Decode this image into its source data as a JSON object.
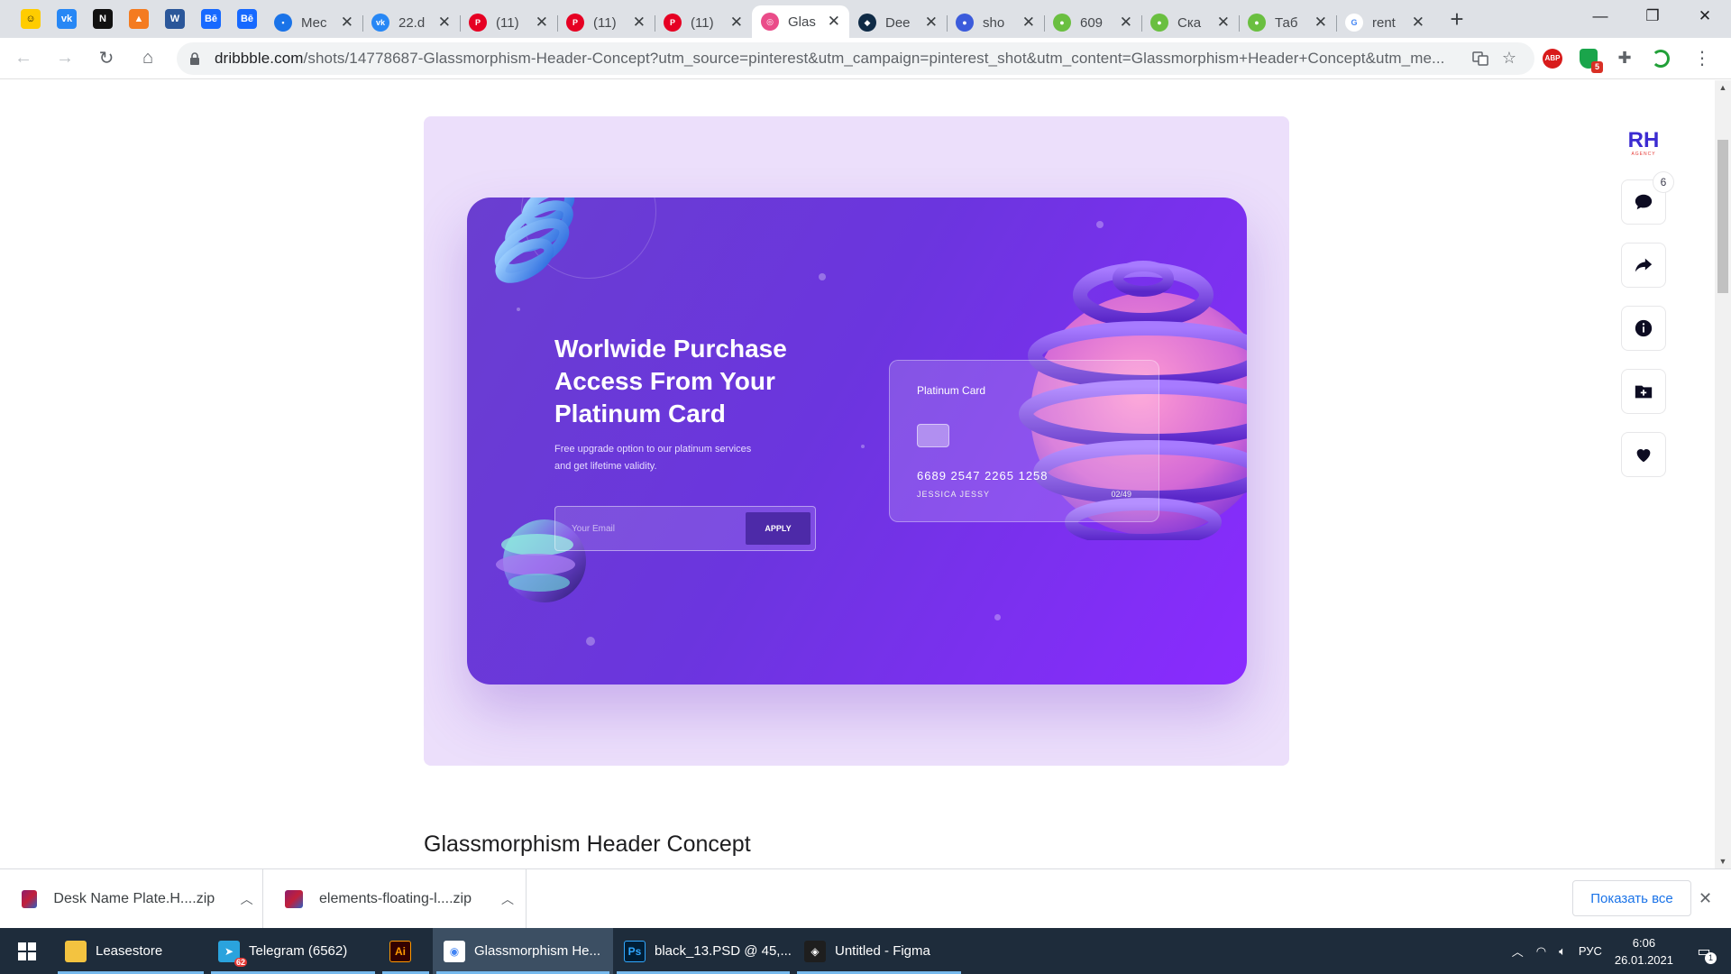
{
  "browser": {
    "pinned_tabs": [
      {
        "icon": "yandex-smile-icon",
        "color": "#ffcc00",
        "glyph": "☺"
      },
      {
        "icon": "vk-icon",
        "color": "#2787f5",
        "glyph": "vk"
      },
      {
        "icon": "notion-icon",
        "color": "#111111",
        "glyph": "N"
      },
      {
        "icon": "tilda-icon",
        "color": "#f47b20",
        "glyph": "▲"
      },
      {
        "icon": "word-icon",
        "color": "#2b579a",
        "glyph": "W"
      },
      {
        "icon": "behance-icon",
        "color": "#1769ff",
        "glyph": "Bē"
      },
      {
        "icon": "behance-icon",
        "color": "#1769ff",
        "glyph": "Bē"
      }
    ],
    "tabs": [
      {
        "title": "Мес",
        "icon": "chat-icon",
        "color": "#1a73e8",
        "glyph": "▪",
        "active": false
      },
      {
        "title": "22.d",
        "icon": "vk-icon",
        "color": "#2787f5",
        "glyph": "vk",
        "active": false
      },
      {
        "title": "(11)",
        "icon": "pinterest-icon",
        "color": "#e60023",
        "glyph": "P",
        "active": false
      },
      {
        "title": "(11)",
        "icon": "pinterest-icon",
        "color": "#e60023",
        "glyph": "P",
        "active": false
      },
      {
        "title": "(11)",
        "icon": "pinterest-icon",
        "color": "#e60023",
        "glyph": "P",
        "active": false
      },
      {
        "title": "Glas",
        "icon": "dribbble-icon",
        "color": "#ea4c89",
        "glyph": "◎",
        "active": true
      },
      {
        "title": "Dee",
        "icon": "deepl-icon",
        "color": "#0f2b46",
        "glyph": "◆",
        "active": false
      },
      {
        "title": "sho",
        "icon": "shop-icon",
        "color": "#3b5bdb",
        "glyph": "●",
        "active": false
      },
      {
        "title": "609",
        "icon": "leaf-icon",
        "color": "#6abf40",
        "glyph": "●",
        "active": false
      },
      {
        "title": "Ска",
        "icon": "leaf-icon",
        "color": "#6abf40",
        "glyph": "●",
        "active": false
      },
      {
        "title": "Таб",
        "icon": "leaf-icon",
        "color": "#6abf40",
        "glyph": "●",
        "active": false
      },
      {
        "title": "rent",
        "icon": "google-icon",
        "color": "#ffffff",
        "glyph": "G",
        "active": false
      }
    ],
    "new_tab_symbol": "+",
    "window_controls": {
      "minimize": "—",
      "restore": "❐",
      "close": "✕"
    },
    "nav": {
      "back": "←",
      "forward": "→",
      "reload": "↻",
      "home": "⌂"
    },
    "url_domain": "dribbble.com",
    "url_path": "/shots/14778687-Glassmorphism-Header-Concept?utm_source=pinterest&utm_campaign=pinterest_shot&utm_content=Glassmorphism+Header+Concept&utm_me...",
    "extensions": {
      "abp_label": "ABP",
      "shield_badge": "5"
    }
  },
  "shot": {
    "heading_line1": "Worlwide Purchase",
    "heading_line2": "Access From Your",
    "heading_line3": "Platinum Card",
    "subtitle_line1": "Free upgrade option to our platinum services",
    "subtitle_line2": "and get lifetime validity.",
    "email_placeholder": "Your Email",
    "apply_label": "APPLY",
    "card_name": "Platinum Card",
    "card_number": "6689 2547 2265 1258",
    "card_holder": "JESSICA JESSY",
    "card_expiry": "02/49",
    "title": "Glassmorphism Header Concept"
  },
  "rail": {
    "logo_text": "RH",
    "logo_subtext": "AGENCY",
    "comment_count": "6",
    "buttons": [
      "comment-icon",
      "share-icon",
      "info-icon",
      "add-to-collection-icon",
      "like-heart-icon"
    ]
  },
  "downloads": {
    "items": [
      {
        "name": "Desk Name Plate.H....zip"
      },
      {
        "name": "elements-floating-l....zip"
      }
    ],
    "show_all_label": "Показать все"
  },
  "taskbar": {
    "items": [
      {
        "label": "Leasestore",
        "icon": "file-explorer-icon",
        "color": "#f3c340",
        "glyph": "▮",
        "active": false,
        "width": 170
      },
      {
        "label": "Telegram (6562)",
        "icon": "telegram-icon",
        "color": "#2aa3dd",
        "glyph": "➤",
        "active": false,
        "width": 190,
        "badge": "62"
      },
      {
        "label": "",
        "icon": "illustrator-icon",
        "color": "#330000",
        "glyph": "Ai",
        "active": false,
        "width": 60
      },
      {
        "label": "Glassmorphism He...",
        "icon": "chrome-icon",
        "color": "#ffffff",
        "glyph": "◉",
        "active": true,
        "width": 200
      },
      {
        "label": "black_13.PSD @ 45,...",
        "icon": "photoshop-icon",
        "color": "#001e36",
        "glyph": "Ps",
        "active": false,
        "width": 200
      },
      {
        "label": "Untitled - Figma",
        "icon": "figma-icon",
        "color": "#1e1e1e",
        "glyph": "◈",
        "active": false,
        "width": 190
      }
    ],
    "language": "РУС",
    "time": "6:06",
    "date": "26.01.2021",
    "notification_count": "1"
  }
}
